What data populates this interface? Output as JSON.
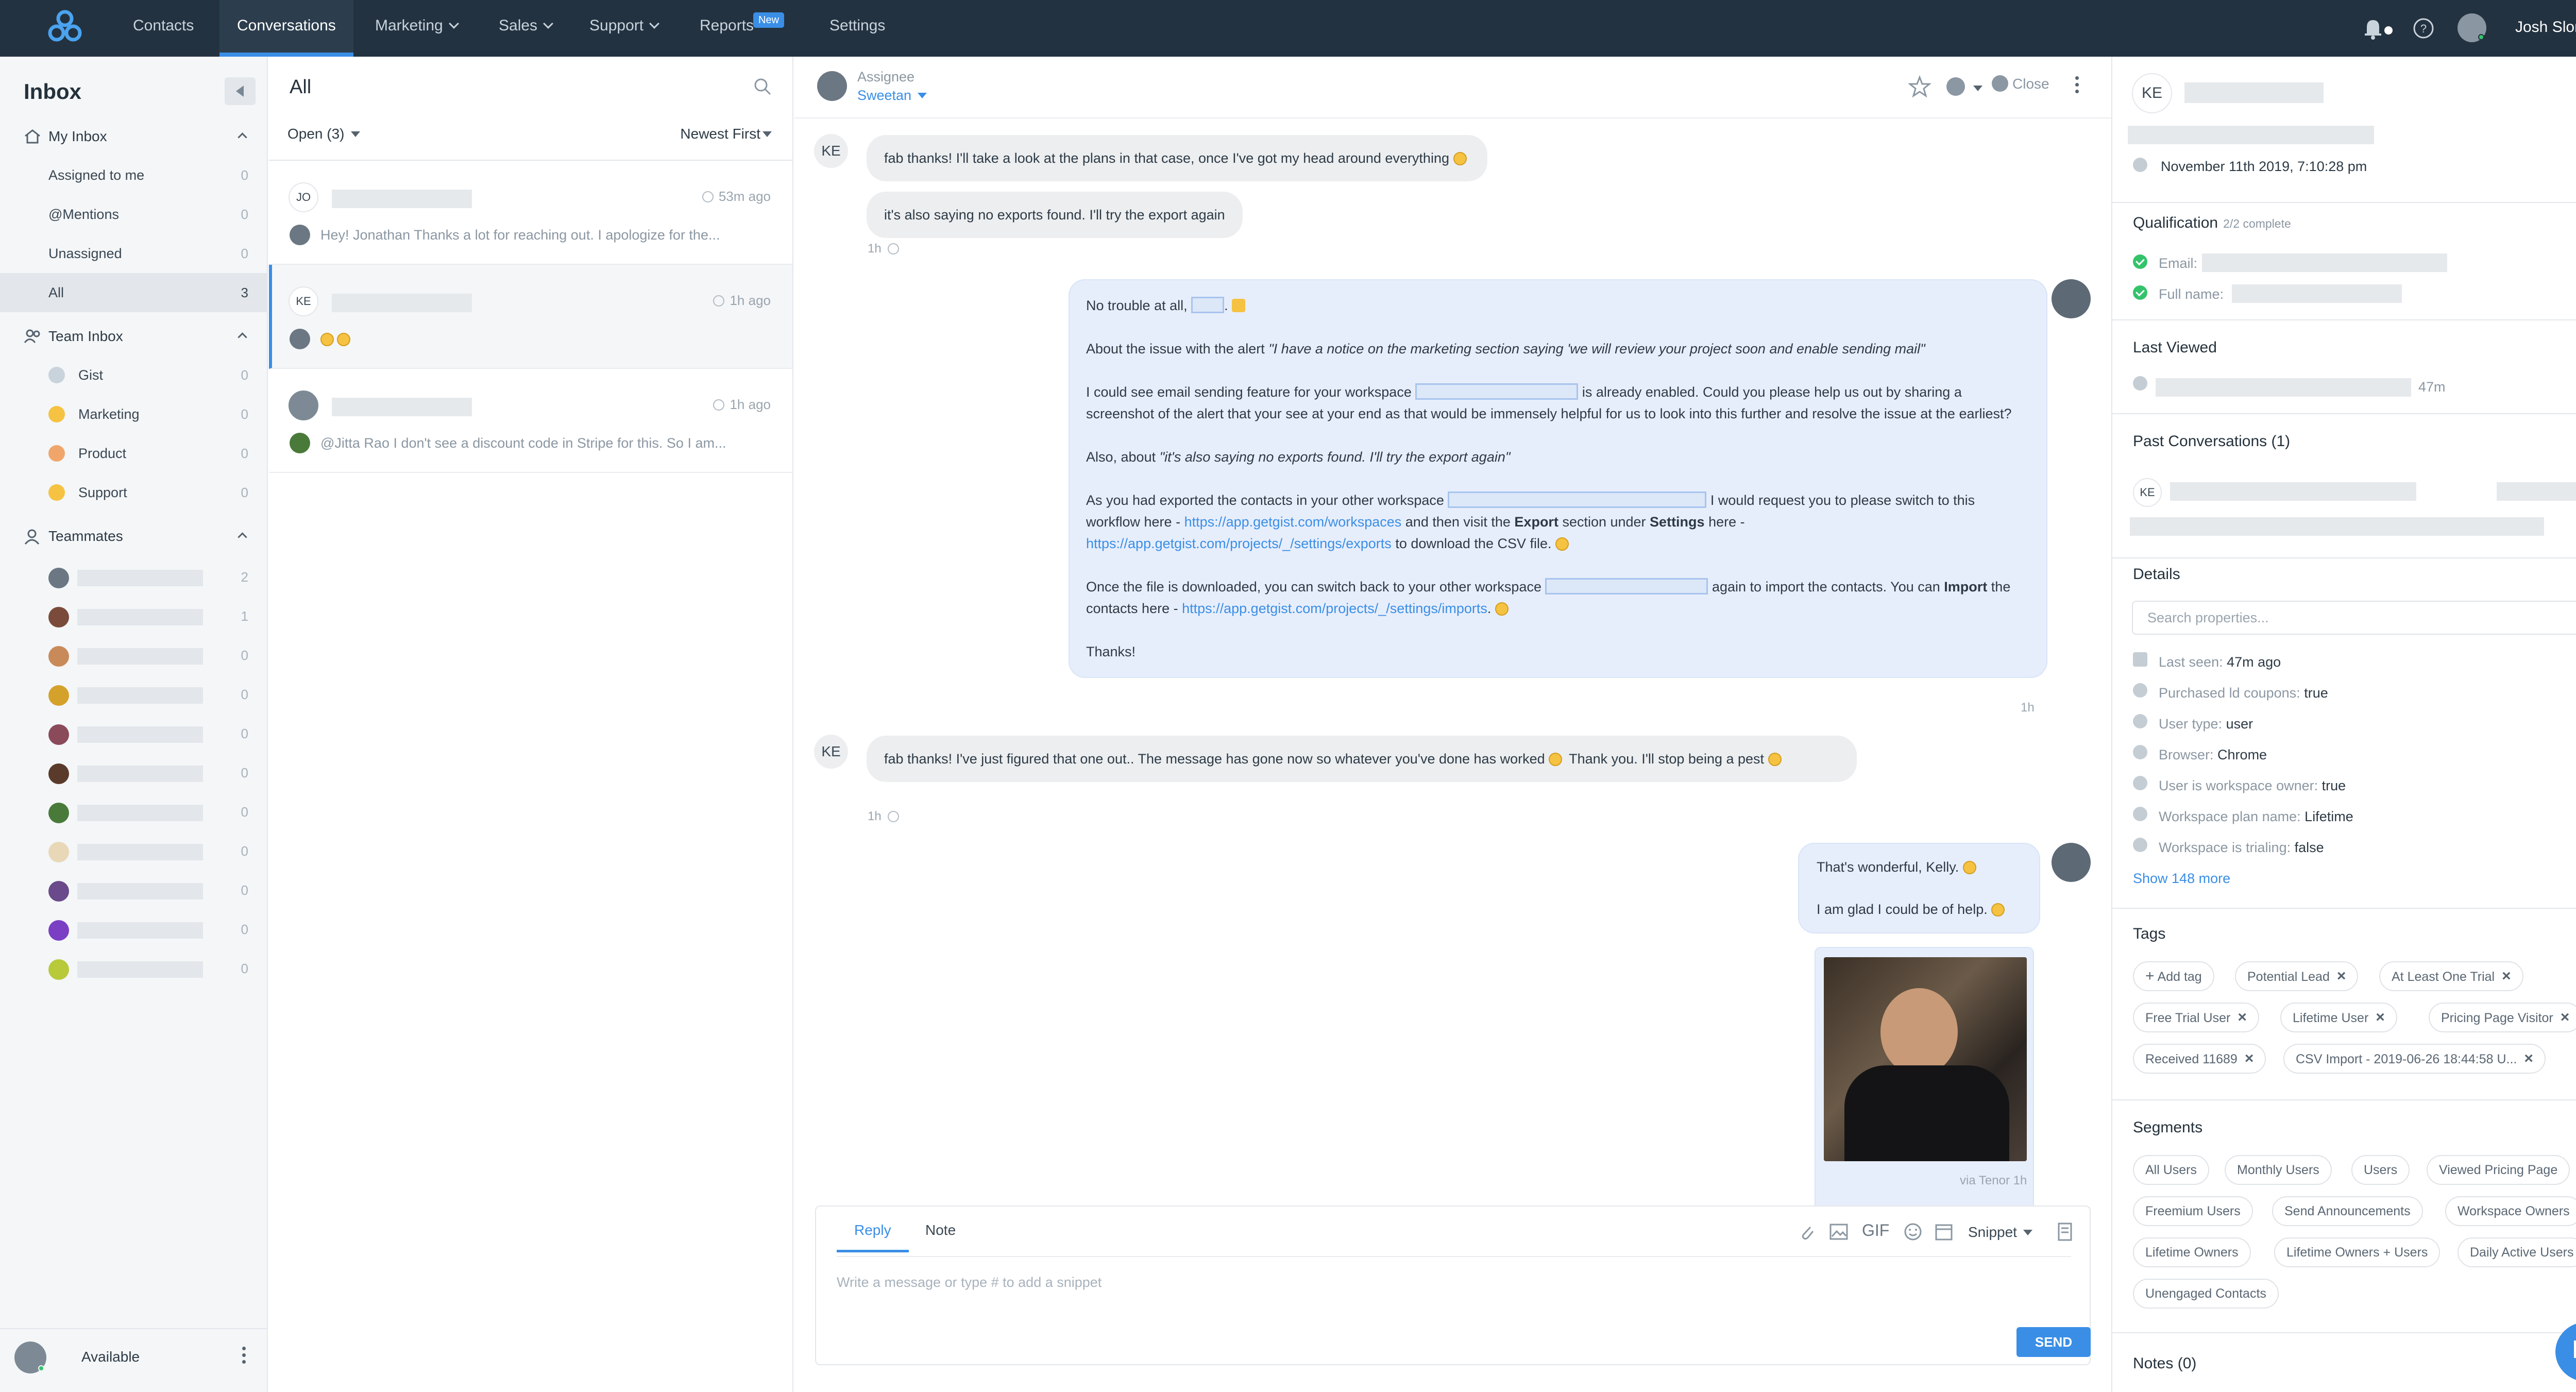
{
  "nav": {
    "items": [
      "Contacts",
      "Conversations",
      "Marketing",
      "Sales",
      "Support",
      "Reports",
      "Settings"
    ],
    "badge_new": "New",
    "user_name": "Josh Slone"
  },
  "sidebar": {
    "title": "Inbox",
    "my_inbox": {
      "label": "My Inbox",
      "items": [
        {
          "label": "Assigned to me",
          "count": "0"
        },
        {
          "label": "@Mentions",
          "count": "0"
        },
        {
          "label": "Unassigned",
          "count": "0"
        },
        {
          "label": "All",
          "count": "3"
        }
      ]
    },
    "team_inbox": {
      "label": "Team Inbox",
      "items": [
        {
          "label": "Gist",
          "count": "0"
        },
        {
          "label": "Marketing",
          "count": "0"
        },
        {
          "label": "Product",
          "count": "0"
        },
        {
          "label": "Support",
          "count": "0"
        }
      ]
    },
    "teammates": {
      "label": "Teammates",
      "counts": [
        "2",
        "1",
        "0",
        "0",
        "0",
        "0",
        "0",
        "0",
        "0",
        "0",
        "0"
      ]
    },
    "footer_status": "Available"
  },
  "conversation_list": {
    "title": "All",
    "filter": "Open (3)",
    "sort": "Newest First",
    "items": [
      {
        "initials": "JO",
        "time": "53m ago",
        "preview": "Hey! Jonathan Thanks a lot for reaching out. I apologize for the..."
      },
      {
        "initials": "KE",
        "time": "1h ago",
        "preview": ""
      },
      {
        "initials": "",
        "time": "1h ago",
        "preview": "@Jitta Rao I don't see a discount code in Stripe for this. So I am..."
      }
    ]
  },
  "chat": {
    "assignee_label": "Assignee",
    "assignee_name": "Sweetan",
    "close_label": "Close",
    "messages": {
      "m1": "fab thanks! I'll take a look at the plans in that case, once I've got my head around everything",
      "m2": "it's also saying no exports found. I'll try the export again",
      "m2_time": "1h",
      "out1": {
        "p1": "No trouble at all,",
        "p2a": "About the issue with the alert ",
        "p2b": "\"I have a notice on the marketing section saying 'we will review your project soon and enable sending mail\"",
        "p3a": "I could see email sending feature for your workspace ",
        "p3b": " is already enabled. Could you please help us out by sharing a screenshot of the alert that your see at your end as that would be immensely helpful for us to look into this further and resolve the issue at the earliest?",
        "p4a": "Also, about ",
        "p4b": "\"it's also saying no exports found. I'll try the export again\"",
        "p5a": "As you had exported the contacts in your other workspace ",
        "p5b": " I would request you to please switch to this workflow here - ",
        "p5link1": "https://app.getgist.com/workspaces",
        "p5c": " and then visit the ",
        "p5bold1": "Export",
        "p5d": " section under ",
        "p5bold2": "Settings",
        "p5e": " here - ",
        "p5link2": "https://app.getgist.com/projects/_/settings/exports",
        "p5f": " to download the CSV file.",
        "p6a": "Once the file is downloaded, you can switch back to your other workspace ",
        "p6b": " again to import the contacts. You can ",
        "p6bold": "Import",
        "p6c": " the contacts here - ",
        "p6link": "https://app.getgist.com/projects/_/settings/imports",
        "p7": "Thanks!",
        "time": "1h"
      },
      "m3": "fab thanks! I've just figured that one out.. The message has gone now so whatever you've done has worked",
      "m3b": "Thank you. I'll stop being a pest",
      "m3_time": "1h",
      "out2_line1": "That's wonderful, Kelly.",
      "out2_line2": "I am glad I could be of help.",
      "gif_caption": "via Tenor",
      "gif_time": "1h"
    },
    "composer": {
      "tab_reply": "Reply",
      "tab_note": "Note",
      "gif_label": "GIF",
      "snippet_label": "Snippet",
      "placeholder": "Write a message or type # to add a snippet",
      "send_label": "SEND"
    },
    "init_ke": "KE"
  },
  "right_panel": {
    "initials": "KE",
    "created": "November 11th 2019, 7:10:28 pm",
    "qualification": {
      "title": "Qualification",
      "progress": "2/2 complete",
      "fields": [
        "Email:",
        "Full name:"
      ]
    },
    "last_viewed": {
      "title": "Last Viewed",
      "time": "47m"
    },
    "past_conversations": {
      "title": "Past Conversations (1)",
      "initials": "KE"
    },
    "details": {
      "title": "Details",
      "search_placeholder": "Search properties...",
      "rows": [
        {
          "key": "Last seen:",
          "value": "47m ago"
        },
        {
          "key": "Purchased ld coupons:",
          "value": "true"
        },
        {
          "key": "User type:",
          "value": "user"
        },
        {
          "key": "Browser:",
          "value": "Chrome"
        },
        {
          "key": "User is workspace owner:",
          "value": "true"
        },
        {
          "key": "Workspace plan name:",
          "value": "Lifetime"
        },
        {
          "key": "Workspace is trialing:",
          "value": "false"
        }
      ],
      "show_more": "Show 148 more"
    },
    "tags": {
      "title": "Tags",
      "add_label": "Add tag",
      "items": [
        "Potential Lead",
        "At Least One Trial",
        "Free Trial User",
        "Lifetime User",
        "Pricing Page Visitor",
        "Received 11689",
        "CSV Import - 2019-06-26 18:44:58 U..."
      ]
    },
    "segments": {
      "title": "Segments",
      "items": [
        "All Users",
        "Monthly Users",
        "Users",
        "Viewed Pricing Page",
        "Freemium Users",
        "Send Announcements",
        "Workspace Owners",
        "Lifetime Owners",
        "Lifetime Owners + Users",
        "Daily Active Users",
        "Unengaged Contacts"
      ]
    },
    "notes_title": "Notes (0)"
  }
}
